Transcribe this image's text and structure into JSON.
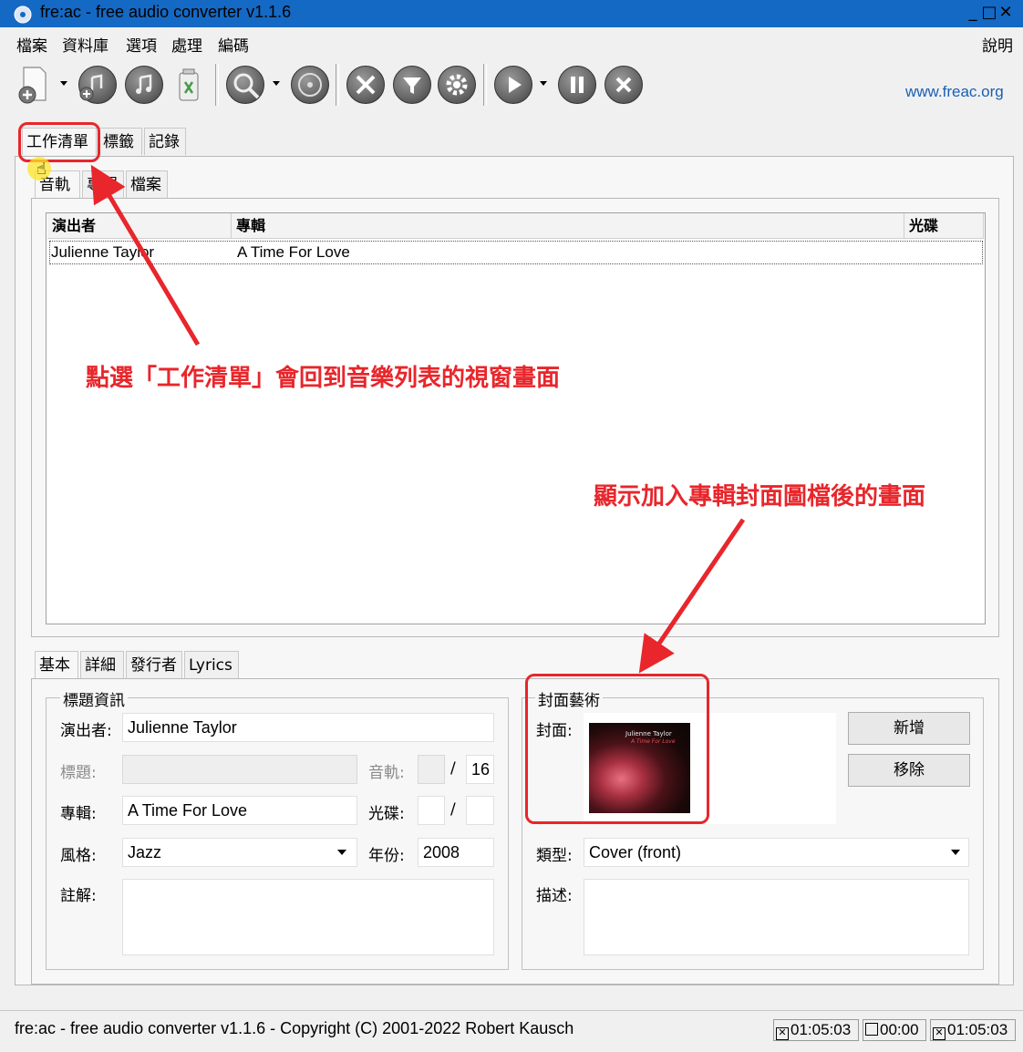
{
  "window": {
    "title": "fre:ac - free audio converter v1.1.6",
    "controls": [
      "_",
      "□",
      "✕"
    ]
  },
  "menu": {
    "items": [
      "檔案",
      "資料庫",
      "選項",
      "處理",
      "編碼"
    ],
    "help": "說明"
  },
  "toolbar": {
    "icons": [
      "add-files-icon",
      "add-folder-icon",
      "add-cd-icon",
      "clear-list-icon",
      "query-cddb-icon",
      "cd-submit-icon",
      "config-tools-icon",
      "filter-icon",
      "settings-gear-icon",
      "play-icon",
      "pause-icon",
      "stop-icon"
    ],
    "website": "www.freac.org"
  },
  "tabs": {
    "main": [
      "工作清單",
      "標籤",
      "記錄"
    ],
    "sub": [
      "音軌",
      "專輯",
      "檔案"
    ],
    "info": [
      "基本",
      "詳細",
      "發行者",
      "Lyrics"
    ]
  },
  "list": {
    "columns": [
      "演出者",
      "專輯",
      "光碟"
    ],
    "rows": [
      {
        "artist": "Julienne Taylor",
        "album": "A Time For Love",
        "disc": ""
      }
    ]
  },
  "basic": {
    "group_title": "標題資訊",
    "artist_label": "演出者:",
    "artist_value": "Julienne Taylor",
    "title_label": "標題:",
    "title_value": "",
    "track_label": "音軌:",
    "track_value": "",
    "track_total": "16",
    "slash": "/",
    "album_label": "專輯:",
    "album_value": "A Time For Love",
    "disc_label": "光碟:",
    "disc_value": "",
    "disc_total": "",
    "genre_label": "風格:",
    "genre_value": "Jazz",
    "year_label": "年份:",
    "year_value": "2008",
    "comment_label": "註解:",
    "comment_value": ""
  },
  "cover": {
    "group_title": "封面藝術",
    "cover_label": "封面:",
    "cover_caption": "Julienne Taylor",
    "cover_caption2": "A Time For Love",
    "add_button": "新增",
    "remove_button": "移除",
    "type_label": "類型:",
    "type_value": "Cover (front)",
    "desc_label": "描述:",
    "desc_value": ""
  },
  "status": {
    "text": "fre:ac - free audio converter v1.1.6 - Copyright (C) 2001-2022 Robert Kausch",
    "time_selected": "01:05:03",
    "time_current": "00:00",
    "time_total": "01:05:03"
  },
  "annotations": {
    "note1": "點選「工作清單」會回到音樂列表的視窗畫面",
    "note2": "顯示加入專輯封面圖檔後的畫面"
  },
  "colors": {
    "titlebar": "#1469c4",
    "annotation_red": "#e8262b",
    "link_blue": "#1a5fb4"
  }
}
